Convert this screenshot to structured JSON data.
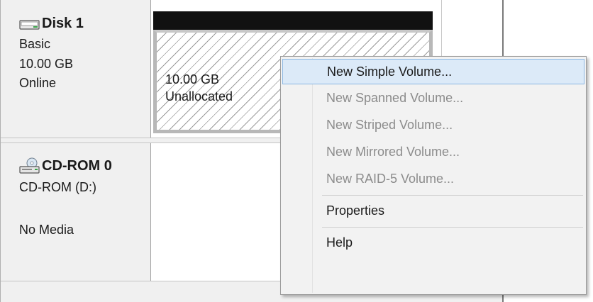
{
  "disk1": {
    "title": "Disk 1",
    "type": "Basic",
    "size": "10.00 GB",
    "status": "Online",
    "partition": {
      "size": "10.00 GB",
      "state": "Unallocated"
    }
  },
  "cdrom": {
    "title": "CD-ROM 0",
    "drive": "CD-ROM (D:)",
    "status": "No Media"
  },
  "context_menu": {
    "items": [
      {
        "label": "New Simple Volume...",
        "enabled": true,
        "highlighted": true
      },
      {
        "label": "New Spanned Volume...",
        "enabled": false
      },
      {
        "label": "New Striped Volume...",
        "enabled": false
      },
      {
        "label": "New Mirrored Volume...",
        "enabled": false
      },
      {
        "label": "New RAID-5 Volume...",
        "enabled": false
      },
      {
        "label": "Properties",
        "enabled": true
      },
      {
        "label": "Help",
        "enabled": true
      }
    ]
  },
  "icons": {
    "disk": "disk-drive-icon",
    "cdrom": "cd-rom-icon"
  },
  "colors": {
    "highlight_bg": "#dceaf8",
    "highlight_border": "#8ab7e3",
    "partition_header": "#111111",
    "disabled_text": "#8c8c8c"
  }
}
